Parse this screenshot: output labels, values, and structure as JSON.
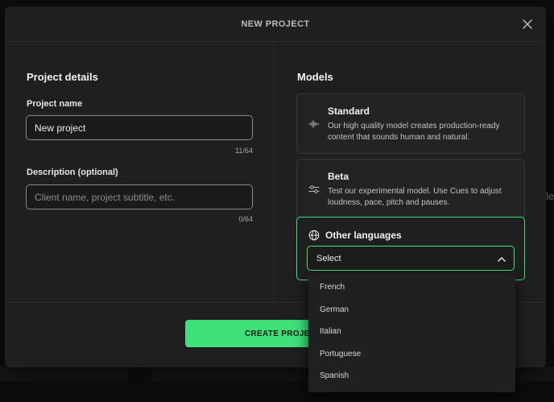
{
  "modal": {
    "title": "NEW PROJECT",
    "close_icon": "close-icon"
  },
  "project_details": {
    "heading": "Project details",
    "name": {
      "label": "Project name",
      "value": "New project",
      "counter": "11/64"
    },
    "description": {
      "label": "Description (optional)",
      "value": "",
      "placeholder": "Client name, project subtitle, etc.",
      "counter": "0/64"
    }
  },
  "models": {
    "heading": "Models",
    "cards": [
      {
        "title": "Standard",
        "description": "Our high quality model creates production-ready content that sounds human and natural.",
        "icon": "waveform-icon"
      },
      {
        "title": "Beta",
        "description": "Test our experimental model. Use Cues to adjust loudness, pace, pitch and pauses.",
        "icon": "sliders-icon"
      }
    ],
    "other_languages": {
      "title": "Other languages",
      "icon": "globe-icon",
      "select_value": "Select",
      "chevron_icon": "chevron-up-icon",
      "options": [
        "French",
        "German",
        "Italian",
        "Portuguese",
        "Spanish"
      ]
    }
  },
  "footer": {
    "create_label": "CREATE PROJECT"
  },
  "background": {
    "edge_text": "le"
  },
  "colors": {
    "accent": "#3ee07a",
    "surface": "#1f1f1f",
    "backdrop": "#0d0d0d"
  }
}
